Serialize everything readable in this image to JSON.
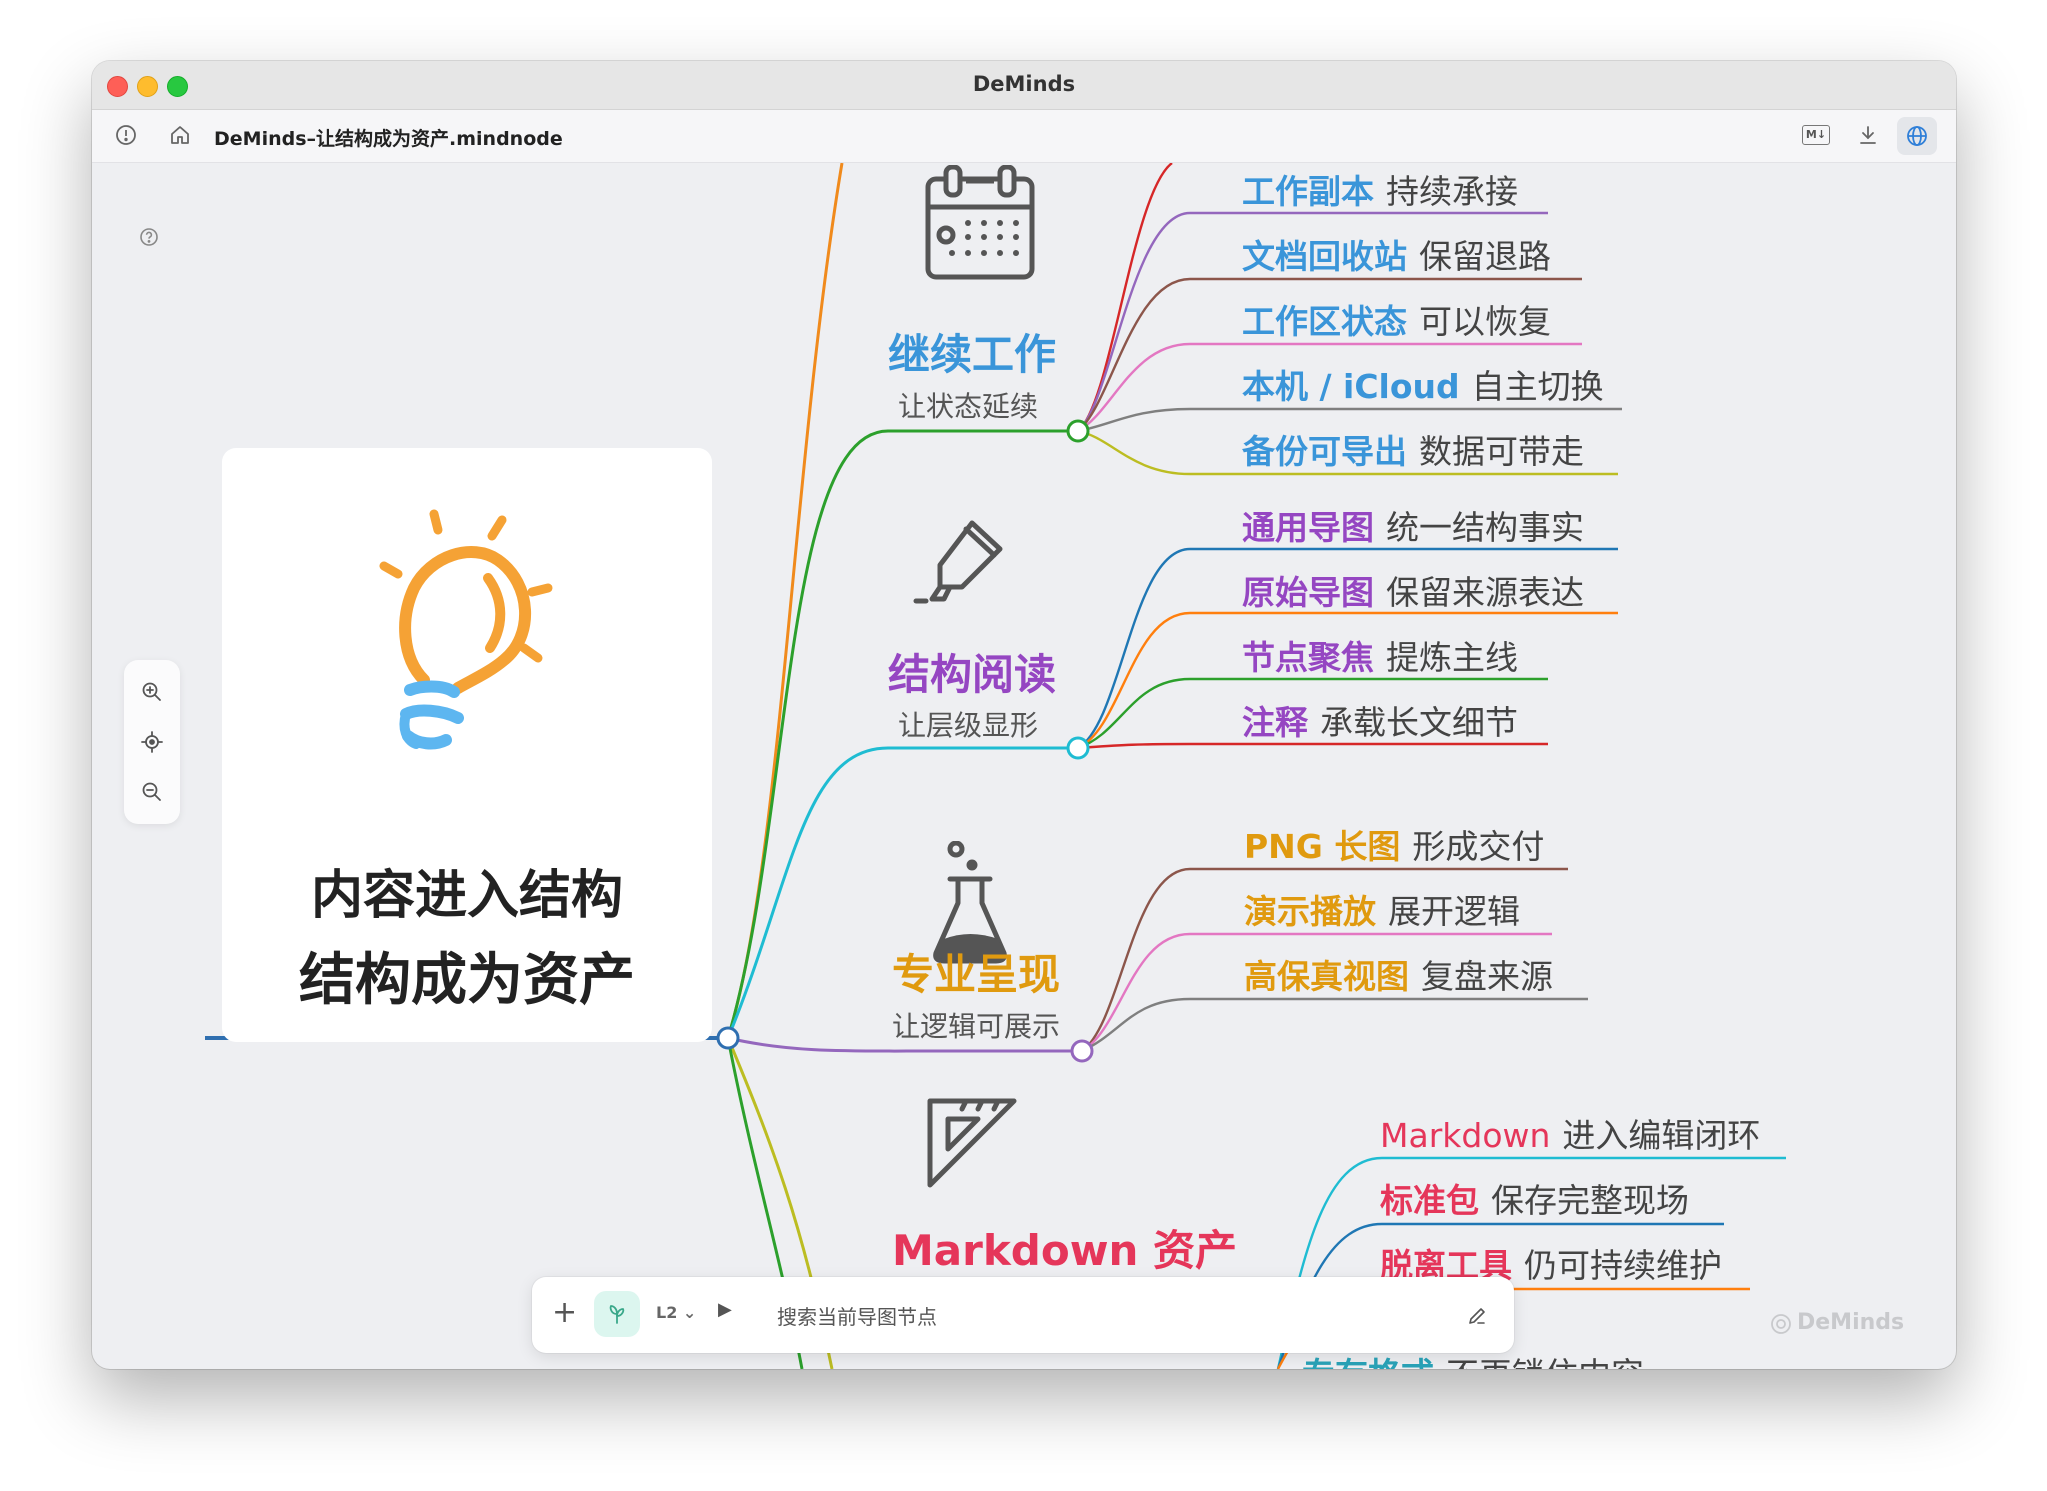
{
  "window": {
    "title": "DeMinds"
  },
  "toolbar": {
    "doc_title": "DeMinds–让结构成为资产.mindnode",
    "md_badge": "M↓"
  },
  "root": {
    "line1": "内容进入结构",
    "line2": "结构成为资产"
  },
  "branches": [
    {
      "title": "继续工作",
      "subtitle": "让状态延续",
      "color": "#3a95d9",
      "icon": "calendar-icon",
      "leaves": [
        {
          "key": "工作副本",
          "value": "持续承接"
        },
        {
          "key": "文档回收站",
          "value": "保留退路"
        },
        {
          "key": "工作区状态",
          "value": "可以恢复"
        },
        {
          "key": "本机 / iCloud",
          "value": "自主切换"
        },
        {
          "key": "备份可导出",
          "value": "数据可带走"
        }
      ]
    },
    {
      "title": "结构阅读",
      "subtitle": "让层级显形",
      "color": "#9546c2",
      "icon": "highlighter-icon",
      "leaves": [
        {
          "key": "通用导图",
          "value": "统一结构事实"
        },
        {
          "key": "原始导图",
          "value": "保留来源表达"
        },
        {
          "key": "节点聚焦",
          "value": "提炼主线"
        },
        {
          "key": "注释",
          "value": "承载长文细节"
        }
      ]
    },
    {
      "title": "专业呈现",
      "subtitle": "让逻辑可展示",
      "color": "#e09a0f",
      "icon": "flask-icon",
      "leaves": [
        {
          "key": "PNG 长图",
          "value": "形成交付"
        },
        {
          "key": "演示播放",
          "value": "展开逻辑"
        },
        {
          "key": "高保真视图",
          "value": "复盘来源"
        }
      ]
    },
    {
      "title": "Markdown 资产",
      "subtitle": "",
      "color": "#e5365a",
      "icon": "ruler-triangle-icon",
      "leaves": [
        {
          "key": "Markdown",
          "value": "进入编辑闭环"
        },
        {
          "key": "标准包",
          "value": "保存完整现场"
        },
        {
          "key": "脱离工具",
          "value": "仍可持续维护"
        },
        {
          "key": "专有格式",
          "value": "不再锁住内容"
        }
      ]
    }
  ],
  "search": {
    "level": "L2 ⌄",
    "placeholder": "搜索当前导图节点"
  },
  "watermark": "DeMinds",
  "colors": {
    "accent_blue": "#3a95d9",
    "accent_purple": "#9546c2",
    "accent_gold": "#e09a0f",
    "accent_red": "#e5365a",
    "bulb_orange": "#f5a235",
    "bulb_blue": "#5db6f0"
  }
}
